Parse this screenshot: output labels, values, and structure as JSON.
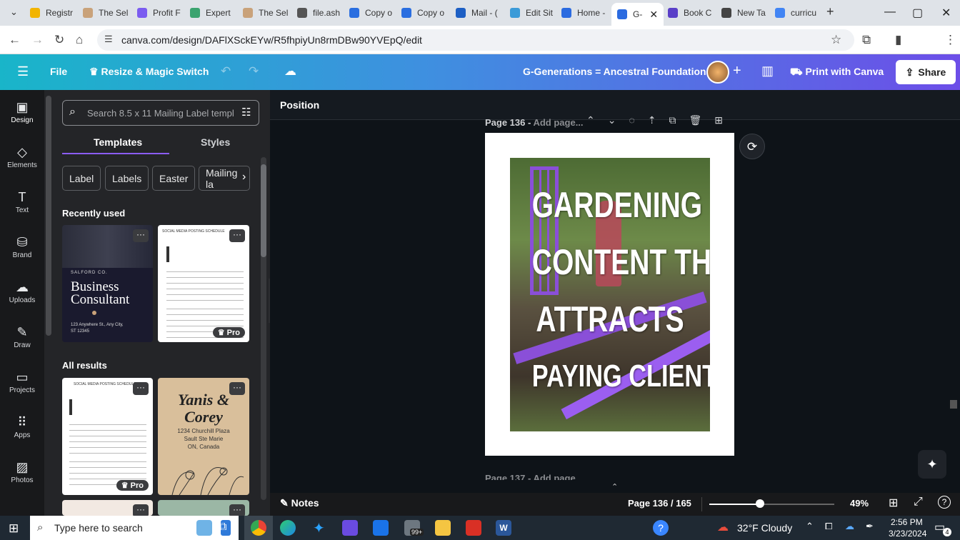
{
  "browser": {
    "tabs": [
      {
        "label": "Registr",
        "color": "#f2b400"
      },
      {
        "label": "The Sel",
        "color": "#c9a27a"
      },
      {
        "label": "Profit F",
        "color": "#7b5cf0"
      },
      {
        "label": "Expert",
        "color": "#3aa36f"
      },
      {
        "label": "The Sel",
        "color": "#c9a27a"
      },
      {
        "label": "file.ash",
        "color": "#555555"
      },
      {
        "label": "Copy o",
        "color": "#2a6ee0"
      },
      {
        "label": "Copy o",
        "color": "#2a6ee0"
      },
      {
        "label": "Mail - (",
        "color": "#1d5fc4"
      },
      {
        "label": "Edit Sit",
        "color": "#3b9bd8"
      },
      {
        "label": "Home -",
        "color": "#2b6be0"
      },
      {
        "label": "G-",
        "color": "#2b6be0",
        "active": true
      },
      {
        "label": "Book C",
        "color": "#5a3fc8"
      },
      {
        "label": "New Ta",
        "color": "#444444"
      },
      {
        "label": "curricu",
        "color": "#4285f4"
      }
    ],
    "url": "canva.com/design/DAFlXSckEYw/R5fhpiyUn8rmDBw90YVEpQ/edit"
  },
  "header": {
    "file_label": "File",
    "resize_label": "Resize & Magic Switch",
    "doc_title": "G-Generations = Ancestral Foundations",
    "print_label": "Print with Canva",
    "share_label": "Share"
  },
  "rail": [
    {
      "label": "Design",
      "icon": "design-icon"
    },
    {
      "label": "Elements",
      "icon": "elements-icon"
    },
    {
      "label": "Text",
      "icon": "text-icon"
    },
    {
      "label": "Brand",
      "icon": "brand-icon"
    },
    {
      "label": "Uploads",
      "icon": "uploads-icon"
    },
    {
      "label": "Draw",
      "icon": "draw-icon"
    },
    {
      "label": "Projects",
      "icon": "projects-icon"
    },
    {
      "label": "Apps",
      "icon": "apps-icon"
    },
    {
      "label": "Photos",
      "icon": "photos-icon"
    }
  ],
  "panel": {
    "search_placeholder": "Search 8.5 x 11 Mailing Label templ",
    "tab_templates": "Templates",
    "tab_styles": "Styles",
    "chips": [
      "Label",
      "Labels",
      "Easter",
      "Mailing la"
    ],
    "recently_used": "Recently used",
    "all_results": "All results",
    "pro_label": "Pro",
    "business": {
      "company": "SALFORD CO.",
      "title1": "Business",
      "title2": "Consultant",
      "address": "123 Anywhere St., Any City, ST 12345"
    },
    "schedule_title": "SOCIAL MEDIA POSTING SCHEDULE",
    "wedding": {
      "names1": "Yanis &",
      "names2": "Corey",
      "addr1": "1234 Churchill Plaza",
      "addr2": "Sault Ste Marie",
      "addr3": "ON, Canada"
    }
  },
  "canvas": {
    "position_label": "Position",
    "page_label": "Page 136 -",
    "page_add": "Add page...",
    "next_page_label": "Page 137 -",
    "next_page_add": "Add page...",
    "slide_lines": [
      "GARDENING",
      "CONTENT THAT",
      "ATTRACTS",
      "PAYING CLIENTS"
    ]
  },
  "bottom": {
    "notes_label": "Notes",
    "page_counter": "Page 136 / 165",
    "zoom": "49%"
  },
  "taskbar": {
    "search_placeholder": "Type here to search",
    "mail_badge": "99+",
    "weather": "32°F  Cloudy",
    "time": "2:56 PM",
    "date": "3/23/2024",
    "notif_count": "4"
  }
}
